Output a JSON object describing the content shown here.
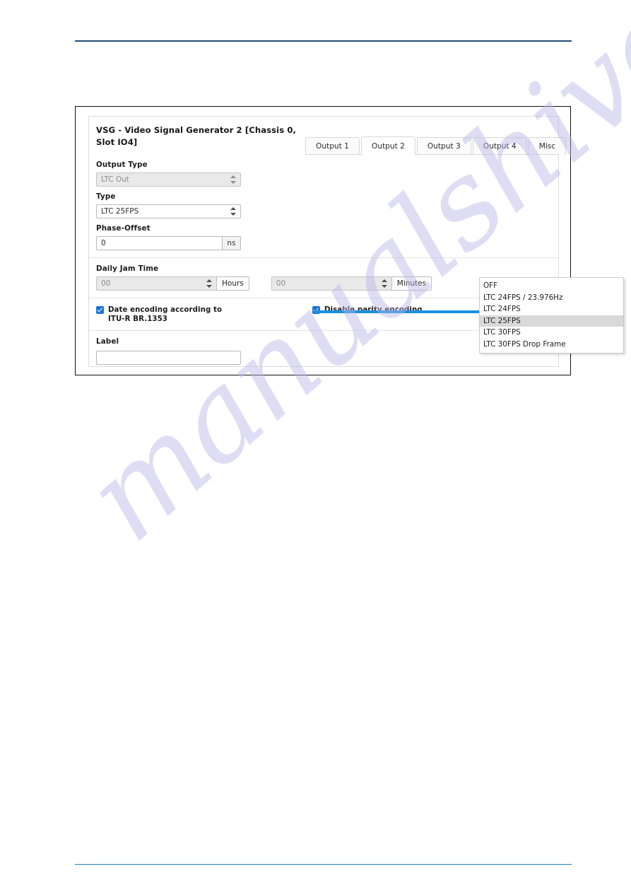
{
  "page": {
    "rules": {
      "top_color": "#1f4e79",
      "bottom_color": "#1f7fb5"
    },
    "watermark": "manualshive.com"
  },
  "panel": {
    "title": "VSG - Video Signal Generator 2 [Chassis 0, Slot IO4]",
    "tabs": [
      {
        "label": "Output 1",
        "active": false
      },
      {
        "label": "Output 2",
        "active": true
      },
      {
        "label": "Output 3",
        "active": false
      },
      {
        "label": "Output 4",
        "active": false
      },
      {
        "label": "Misc",
        "active": false
      }
    ],
    "fields": {
      "output_type": {
        "label": "Output Type",
        "value": "LTC Out",
        "disabled": true
      },
      "type": {
        "label": "Type",
        "value": "LTC 25FPS",
        "disabled": false
      },
      "phase_offset": {
        "label": "Phase-Offset",
        "value": "0",
        "unit": "ns"
      },
      "daily_jam_time": {
        "label": "Daily Jam Time",
        "hours_value": "00",
        "hours_unit": "Hours",
        "minutes_value": "00",
        "minutes_unit": "Minutes"
      },
      "date_encoding": {
        "label": "Date encoding according to ITU-R BR.1353",
        "checked": true
      },
      "disable_parity": {
        "label": "Disable parity encoding",
        "checked": true
      },
      "label_field": {
        "label": "Label",
        "value": "",
        "placeholder": ""
      }
    }
  },
  "dropdown": {
    "open": true,
    "selected": "LTC 25FPS",
    "options": [
      "OFF",
      "LTC 24FPS / 23.976Hz",
      "LTC 24FPS",
      "LTC 25FPS",
      "LTC 30FPS",
      "LTC 30FPS Drop Frame"
    ]
  },
  "colors": {
    "callout": "#1a8fe0",
    "checkbox": "#1a73d4",
    "highlight": "#d9d9d9"
  }
}
